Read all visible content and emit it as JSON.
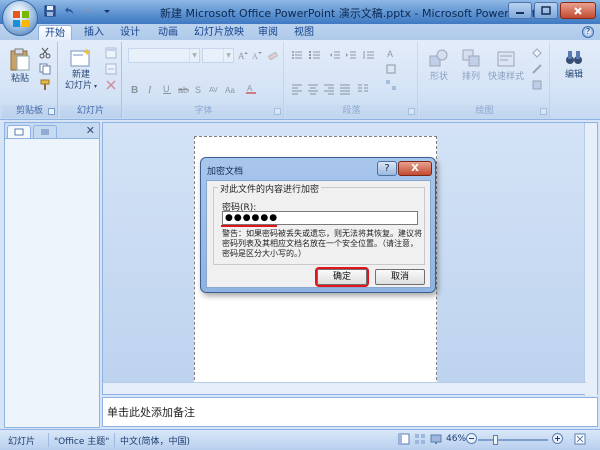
{
  "window": {
    "title": "新建 Microsoft Office PowerPoint 演示文稿.pptx - Microsoft PowerPoint"
  },
  "tabs": [
    "开始",
    "插入",
    "设计",
    "动画",
    "幻灯片放映",
    "审阅",
    "视图"
  ],
  "ribbon": {
    "clipboard": {
      "paste_label": "粘贴",
      "group_label": "剪贴板"
    },
    "slides": {
      "new_slide_label_1": "新建",
      "new_slide_label_2": "幻灯片",
      "group_label": "幻灯片"
    },
    "font": {
      "group_label": "字体"
    },
    "paragraph": {
      "group_label": "段落"
    },
    "drawing": {
      "shape_label": "形状",
      "arrange_label": "排列",
      "quickstyle_label": "快速样式",
      "group_label": "绘图"
    },
    "editing": {
      "label": "编辑"
    }
  },
  "notes": {
    "placeholder": "单击此处添加备注"
  },
  "statusbar": {
    "slide_label": "幻灯片",
    "theme": "\"Office 主题\"",
    "language": "中文(简体，中国)",
    "zoom": "46%"
  },
  "dialog": {
    "title": "加密文档",
    "help_label": "?",
    "close_label": "X",
    "legend": "对此文件的内容进行加密",
    "password_label": "密码(R):",
    "password_value": "●●●●●●",
    "warning": "警告：如果密码被丢失或遗忘，则无法将其恢复。建议将密码列表及其相应文档名放在一个安全位置。（请注意，密码是区分大小写的。）",
    "ok_label": "确定",
    "cancel_label": "取消"
  }
}
